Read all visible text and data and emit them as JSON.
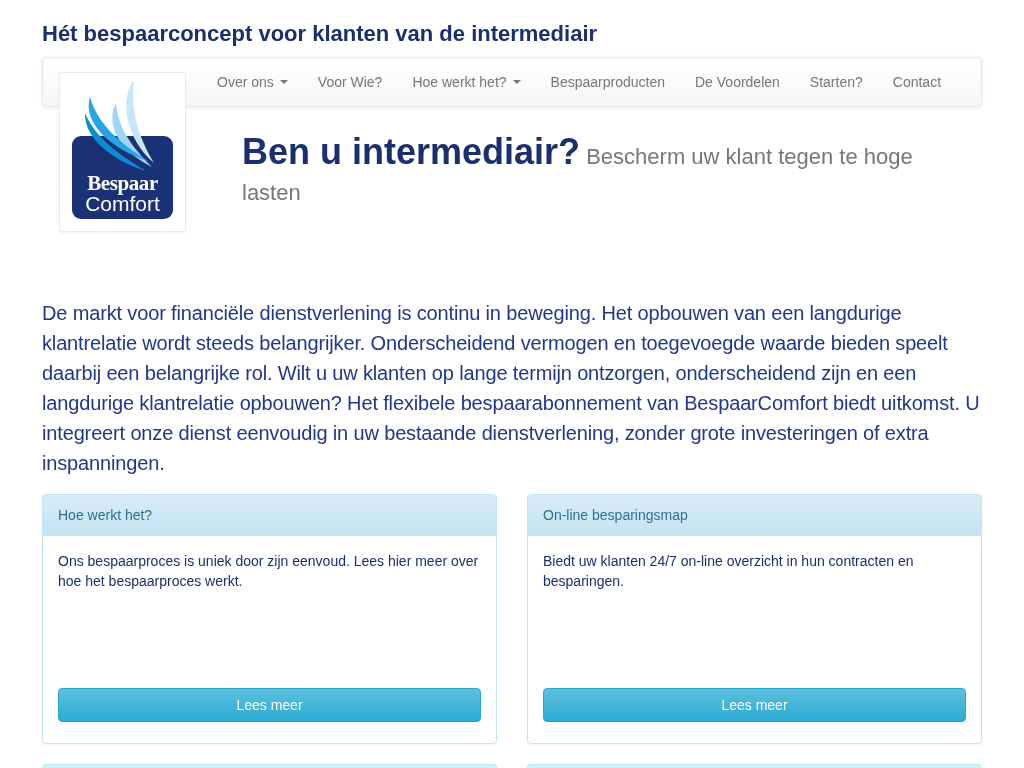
{
  "site_title": "Hét bespaarconcept voor klanten van de intermediair",
  "logo": {
    "line_1": "Bespaar",
    "line_2": "Comfort"
  },
  "nav": {
    "items": [
      {
        "label": "Over ons",
        "kind": "dropdown"
      },
      {
        "label": "Voor Wie?",
        "kind": "link"
      },
      {
        "label": "Hoe werkt het?",
        "kind": "dropdown"
      },
      {
        "label": "Bespaarproducten",
        "kind": "link"
      },
      {
        "label": "De Voordelen",
        "kind": "link"
      },
      {
        "label": "Starten?",
        "kind": "link"
      },
      {
        "label": "Contact",
        "kind": "link"
      }
    ]
  },
  "hero": {
    "title": "Ben u intermediair?",
    "subtitle": "Bescherm uw klant tegen te hoge lasten"
  },
  "intro": "De markt voor financiële dienstverlening is continu in beweging. Het opbouwen van een langdurige klantrelatie wordt steeds belangrijker. Onderscheidend vermogen en toegevoegde waarde bieden speelt daarbij een belangrijke rol. Wilt u uw klanten op lange termijn ontzorgen, onderscheidend zijn en een langdurige klantrelatie opbouwen? Het flexibele bespaarabonnement van BespaarComfort biedt uitkomst. U integreert onze dienst eenvoudig in uw bestaande dienstverlening, zonder grote investeringen of extra inspanningen.",
  "panels": [
    {
      "title": "Hoe werkt het?",
      "body": "Ons bespaarproces is uniek door zijn eenvoud. Lees hier meer over hoe het bespaarproces werkt.",
      "button": "Lees meer"
    },
    {
      "title": "On-line besparingsmap",
      "body": "Biedt uw klanten 24/7 on-line overzicht in hun contracten en besparingen.",
      "button": "Lees meer"
    }
  ]
}
